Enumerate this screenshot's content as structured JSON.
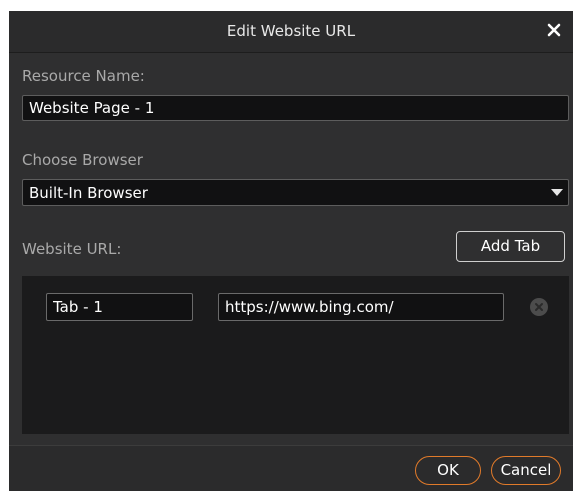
{
  "dialog": {
    "title": "Edit Website URL"
  },
  "form": {
    "resource_name_label": "Resource Name:",
    "resource_name_value": "Website Page - 1",
    "browser_label": "Choose Browser",
    "browser_selected": "Built-In Browser",
    "url_label": "Website URL:",
    "add_tab_label": "Add Tab"
  },
  "tabs": [
    {
      "name": "Tab - 1",
      "url": "https://www.bing.com/"
    }
  ],
  "footer": {
    "ok_label": "OK",
    "cancel_label": "Cancel"
  },
  "colors": {
    "accent": "#e07a2a",
    "background": "#2f2f30",
    "panel": "#1b1b1c"
  },
  "icons": {
    "close": "close-icon",
    "dropdown": "caret-down-icon",
    "remove": "remove-circle-icon"
  }
}
